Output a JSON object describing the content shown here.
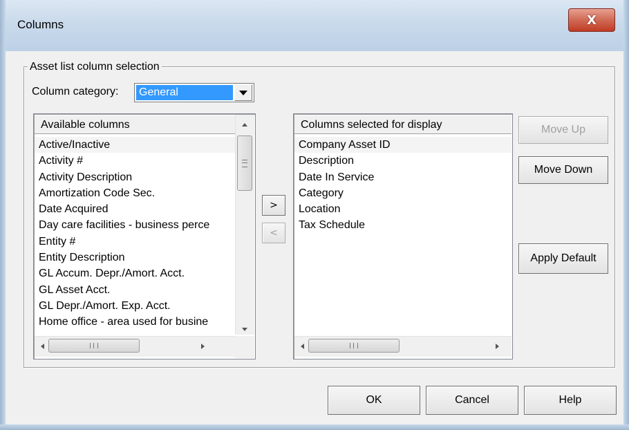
{
  "window": {
    "title": "Columns",
    "close_label": "X"
  },
  "group": {
    "legend": "Asset list column selection",
    "category_label": "Column category:",
    "category_value": "General"
  },
  "available": {
    "header": "Available columns",
    "items": [
      "Active/Inactive",
      "Activity #",
      "Activity Description",
      "Amortization Code Sec.",
      "Date Acquired",
      "Day care facilities - business perce",
      "Entity #",
      "Entity Description",
      "GL Accum. Depr./Amort. Acct.",
      "GL Asset Acct.",
      "GL Depr./Amort. Exp. Acct.",
      "Home office - area used for busine"
    ]
  },
  "selected": {
    "header": "Columns selected for display",
    "items": [
      "Company Asset ID",
      "Description",
      "Date In Service",
      "Category",
      "Location",
      "Tax Schedule"
    ]
  },
  "buttons": {
    "add": ">",
    "remove": "<",
    "move_up": "Move Up",
    "move_down": "Move Down",
    "apply_default": "Apply Default",
    "ok": "OK",
    "cancel": "Cancel",
    "help": "Help"
  },
  "scroll_thumb_grip": "III"
}
